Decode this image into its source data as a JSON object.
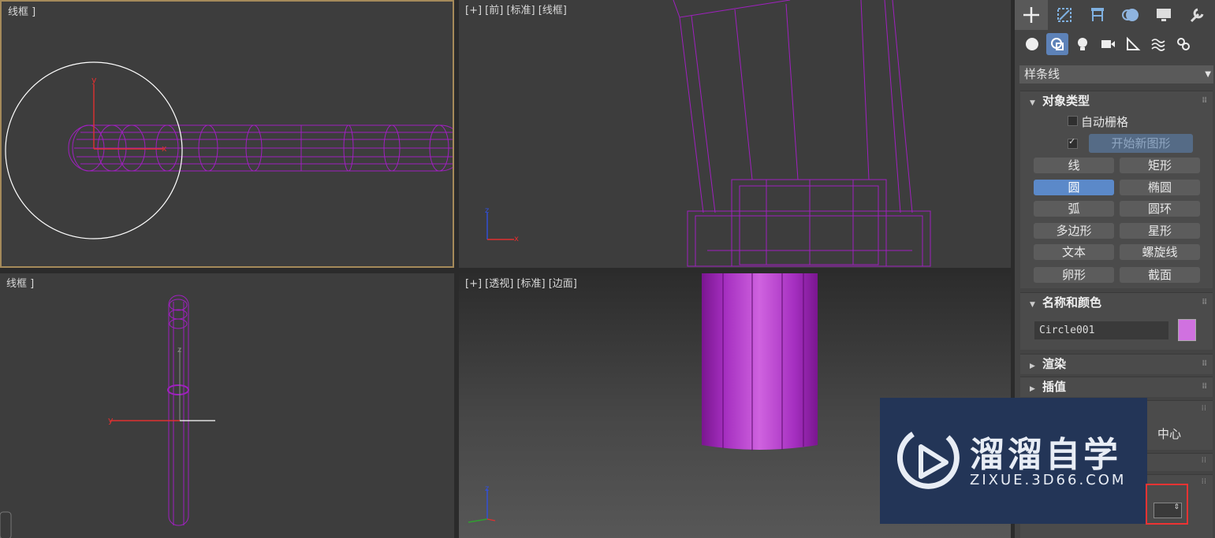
{
  "viewports": {
    "top_label": "线框 ]",
    "front_label": "[+] [前] [标准] [线框]",
    "left_label": "线框 ]",
    "persp_label": "[+] [透视] [标准] [边面]"
  },
  "axes": {
    "x": "x",
    "y": "y",
    "z": "z"
  },
  "panel": {
    "tabs": [
      "create-icon",
      "modify-icon",
      "hierarchy-icon",
      "motion-icon",
      "display-icon",
      "utilities-icon"
    ],
    "subtabs": [
      "geometry-icon",
      "shapes-icon",
      "lights-icon",
      "cameras-icon",
      "helpers-icon",
      "spacewarps-icon",
      "systems-icon"
    ],
    "category": "样条线",
    "object_type": {
      "title": "对象类型",
      "auto_grid": "自动栅格",
      "start_new_shape": "开始新图形",
      "buttons": [
        "线",
        "矩形",
        "圆",
        "椭圆",
        "弧",
        "圆环",
        "多边形",
        "星形",
        "文本",
        "螺旋线",
        "卵形",
        "截面"
      ],
      "selected": "圆"
    },
    "name_color": {
      "title": "名称和颜色",
      "name": "Circle001",
      "color": "#d071e0"
    },
    "render": {
      "title": "渲染"
    },
    "interp": {
      "title": "插值"
    },
    "center": "中心"
  },
  "watermark": {
    "brand": "溜溜自学",
    "url": "ZIXUE.3D66.COM"
  }
}
